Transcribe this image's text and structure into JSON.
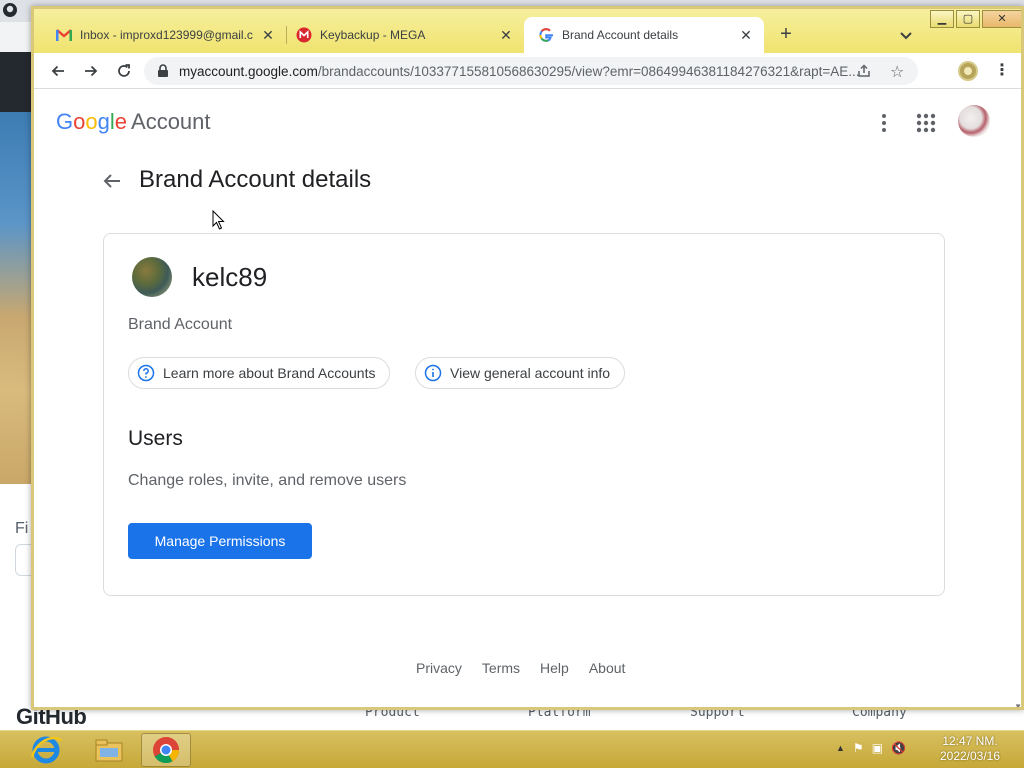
{
  "background_window": {
    "partial_label": "Fi",
    "logo_text": "GitHub",
    "footer_cols": [
      "Product",
      "Platform",
      "Support",
      "Company"
    ]
  },
  "browser": {
    "tabs": [
      {
        "title": "Inbox - improxd123999@gmail.c",
        "icon": "gmail-icon",
        "active": false
      },
      {
        "title": "Keybackup - MEGA",
        "icon": "mega-icon",
        "active": false
      },
      {
        "title": "Brand Account details",
        "icon": "google-icon",
        "active": true
      }
    ],
    "new_tab_label": "+",
    "url_host": "myaccount.google.com",
    "url_path": "/brandaccounts/103377155810568630295/view?emr=08649946381184276321&rapt=AE..."
  },
  "page": {
    "logo_google": [
      "G",
      "o",
      "o",
      "g",
      "l",
      "e"
    ],
    "logo_account": "Account",
    "title": "Brand Account details",
    "account_name": "kelc89",
    "account_type": "Brand Account",
    "chips": [
      {
        "label": "Learn more about Brand Accounts",
        "icon": "help-circle-icon"
      },
      {
        "label": "View general account info",
        "icon": "info-circle-icon"
      }
    ],
    "users_heading": "Users",
    "users_subtitle": "Change roles, invite, and remove users",
    "manage_button": "Manage Permissions",
    "footer": [
      "Privacy",
      "Terms",
      "Help",
      "About"
    ]
  },
  "taskbar": {
    "apps": [
      "internet-explorer-icon",
      "file-explorer-icon",
      "chrome-icon"
    ],
    "time": "12:47 NM.",
    "date": "2022/03/16"
  },
  "colors": {
    "accent": "#1a73e8",
    "tabstrip": "#f0e36f",
    "taskbar": "#c6a838"
  }
}
